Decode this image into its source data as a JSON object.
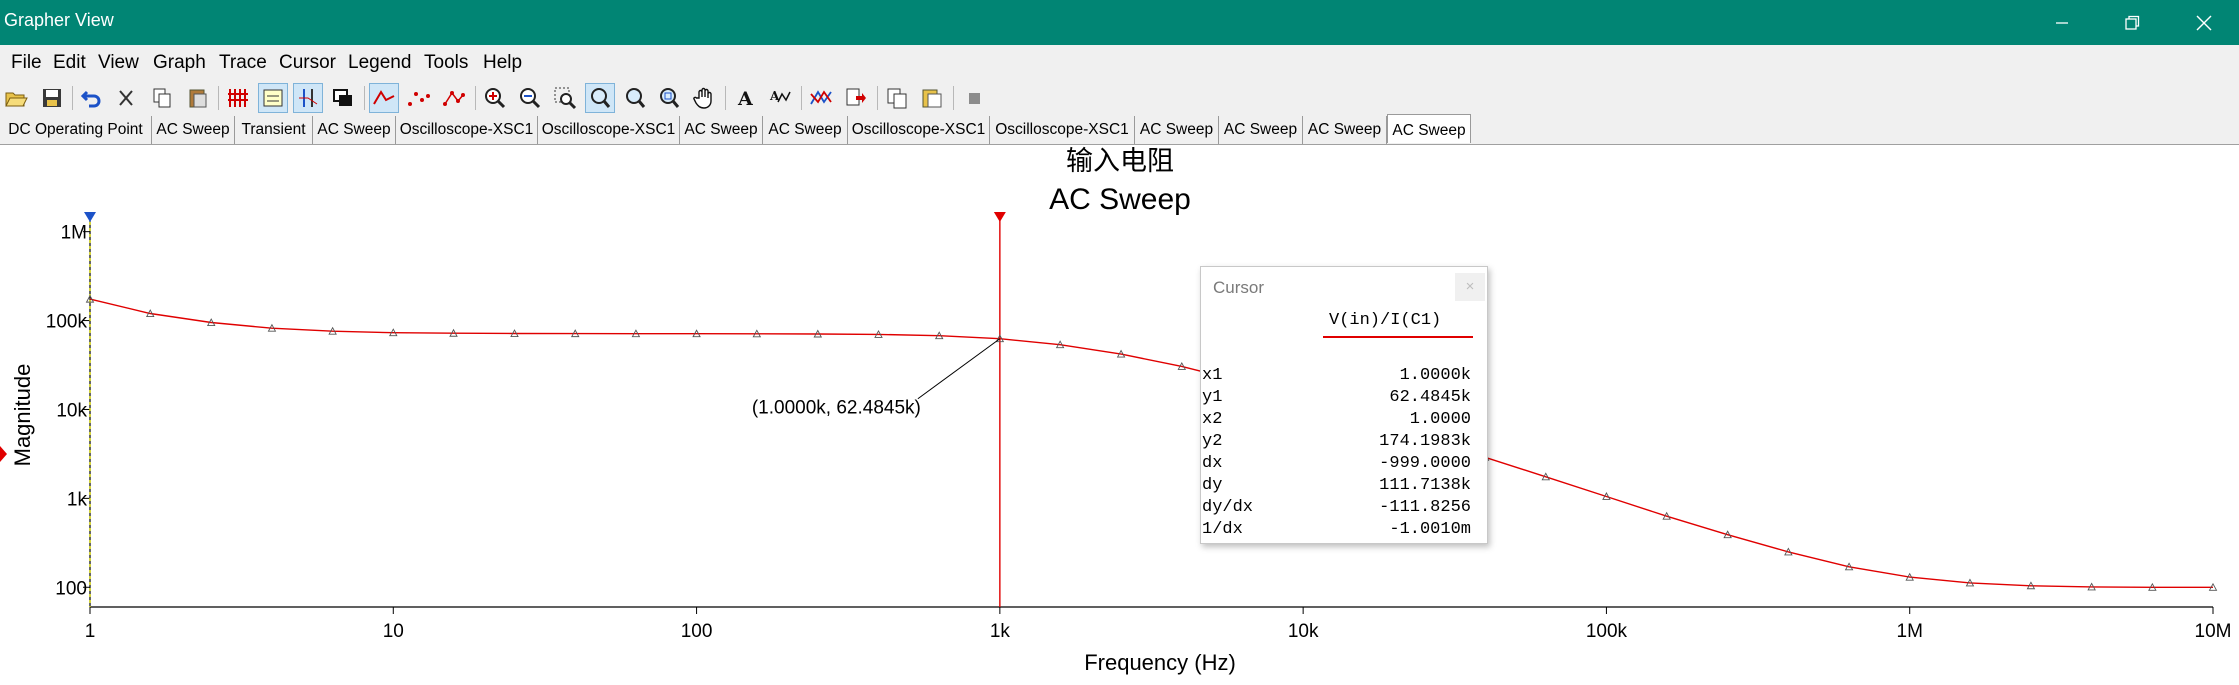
{
  "window": {
    "title": "Grapher View",
    "controls": [
      "minimize-icon",
      "restore-icon",
      "close-icon"
    ]
  },
  "menu": [
    "File",
    "Edit",
    "View",
    "Graph",
    "Trace",
    "Cursor",
    "Legend",
    "Tools",
    "Help"
  ],
  "toolbar_icons": [
    "open-icon",
    "save-icon",
    "undo-icon",
    "cut-icon",
    "copy-icon",
    "paste-icon",
    "grid-icon",
    "legend-icon",
    "cursors-icon",
    "overlay-icon",
    "line-trace-icon",
    "dots-trace-icon",
    "line-dots-trace-icon",
    "zoom-in-icon",
    "zoom-out-icon",
    "zoom-area-icon",
    "zoom-x-icon",
    "zoom-y-icon",
    "zoom-full-icon",
    "pan-icon",
    "text-icon",
    "label-icon",
    "overlay-traces-icon",
    "export-icon",
    "copy-graph-icon",
    "paste-graph-icon",
    "stop-icon"
  ],
  "tabs": [
    "DC Operating Point",
    "AC Sweep",
    "Transient",
    "AC Sweep",
    "Oscilloscope-XSC1",
    "Oscilloscope-XSC1",
    "AC Sweep",
    "AC Sweep",
    "Oscilloscope-XSC1",
    "Oscilloscope-XSC1",
    "AC Sweep",
    "AC Sweep",
    "AC Sweep",
    "AC Sweep"
  ],
  "selected_tab": 13,
  "plot": {
    "annotation": "(1.0000k, 62.4845k)",
    "trace_color": "#e00000",
    "cursor1_color": "#e00000",
    "cursor2_color": "#d8d800"
  },
  "chart_data": {
    "type": "line",
    "title": "输入电阻",
    "subtitle": "AC Sweep",
    "xlabel": "Frequency (Hz)",
    "ylabel": "Magnitude",
    "xscale": "log",
    "yscale": "log",
    "xlim": [
      1,
      10000000
    ],
    "ylim": [
      60,
      1500000
    ],
    "xticks": [
      "1",
      "10",
      "100",
      "1k",
      "10k",
      "100k",
      "1M",
      "10M"
    ],
    "yticks": [
      "100",
      "1k",
      "10k",
      "100k",
      "1M"
    ],
    "series": [
      {
        "name": "V(in)/I(C1)",
        "x": [
          1,
          1.58,
          2.51,
          3.98,
          6.31,
          10,
          15.8,
          25.1,
          39.8,
          63.1,
          100,
          158,
          251,
          398,
          631,
          1000,
          1580,
          2510,
          3980,
          6310,
          10000,
          15800,
          25100,
          39800,
          63100,
          100000,
          158000,
          251000,
          398000,
          631000,
          1000000,
          1580000,
          2510000,
          3980000,
          6310000,
          10000000
        ],
        "y": [
          174198,
          120000,
          95000,
          82000,
          76000,
          73000,
          72000,
          71500,
          71300,
          71200,
          71100,
          71000,
          70600,
          69800,
          67500,
          62485,
          53500,
          42000,
          30500,
          20500,
          13000,
          8000,
          4800,
          2900,
          1750,
          1050,
          630,
          390,
          250,
          170,
          130,
          112,
          104,
          101,
          100,
          100
        ]
      }
    ],
    "cursors": [
      {
        "name": "cursor-1",
        "x": 1000,
        "color": "#e00000"
      },
      {
        "name": "cursor-2",
        "x": 1,
        "color": "#d8d800"
      }
    ]
  },
  "cursor_panel": {
    "title": "Cursor",
    "close": "×",
    "signal": "V(in)/I(C1)",
    "rows": [
      {
        "label": "x1",
        "value": "1.0000k"
      },
      {
        "label": "y1",
        "value": "62.4845k"
      },
      {
        "label": "x2",
        "value": "1.0000"
      },
      {
        "label": "y2",
        "value": "174.1983k"
      },
      {
        "label": "dx",
        "value": "-999.0000"
      },
      {
        "label": "dy",
        "value": "111.7138k"
      },
      {
        "label": "dy/dx",
        "value": "-111.8256"
      },
      {
        "label": "1/dx",
        "value": "-1.0010m"
      }
    ]
  }
}
